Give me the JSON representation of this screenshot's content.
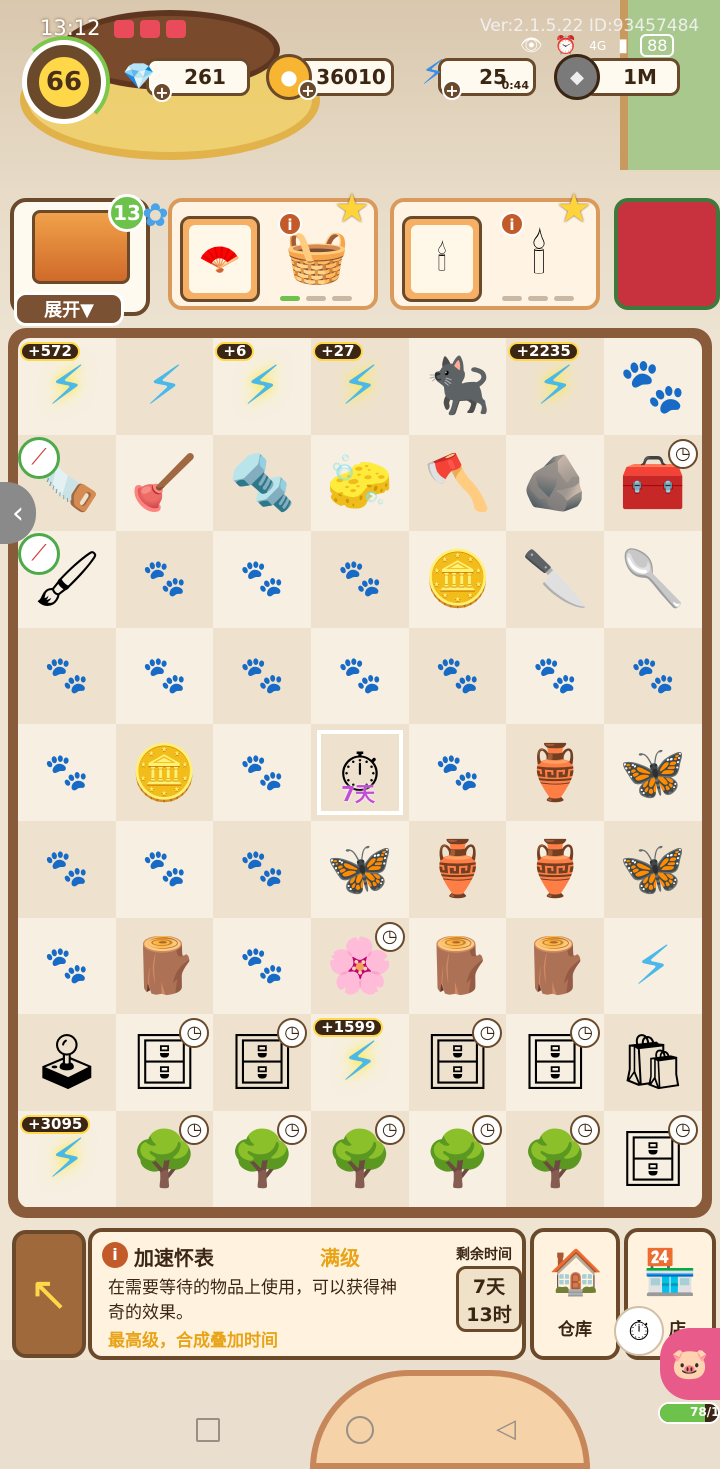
{
  "status_bar": {
    "time": "13:12",
    "version": "Ver:2.1.5.22 ID:93457484",
    "network": "4G",
    "battery": "88"
  },
  "player": {
    "level": "66",
    "level_progress": 0.35
  },
  "resources": {
    "gems": "261",
    "coins": "36010",
    "energy": "25",
    "energy_timer": "0:44",
    "seeds": "1M"
  },
  "chest": {
    "count": "13",
    "expand_label": "展开▼"
  },
  "orders": [
    {
      "tag_icon": "fan-icon",
      "item_icon": "yarn-basket-icon",
      "progress": "1/3"
    },
    {
      "tag_icon": "chandelier-small-icon",
      "item_icon": "chandelier-icon",
      "progress": "0/3"
    }
  ],
  "board": {
    "rows": [
      [
        {
          "icon": "⚡",
          "kind": "energy-machine",
          "bonus": "+572",
          "glow": true
        },
        {
          "icon": "⚡",
          "kind": "energy-shelf"
        },
        {
          "icon": "⚡",
          "kind": "energy-crate",
          "bonus": "+6",
          "glow": true
        },
        {
          "icon": "⚡",
          "kind": "energy-cart",
          "bonus": "+27",
          "glow": true
        },
        {
          "icon": "🐈‍⬛",
          "kind": "black-cat"
        },
        {
          "icon": "⚡",
          "kind": "energy-cart2",
          "bonus": "+2235",
          "glow": true
        },
        {
          "icon": "🐾",
          "kind": "cat-paw-toy"
        }
      ],
      [
        {
          "icon": "🪚",
          "kind": "saw",
          "candy": true
        },
        {
          "icon": "🪠",
          "kind": "plunger"
        },
        {
          "icon": "🔩",
          "kind": "screw"
        },
        {
          "icon": "🧽",
          "kind": "brush"
        },
        {
          "icon": "🪓",
          "kind": "axe"
        },
        {
          "icon": "🪨",
          "kind": "wood-chip"
        },
        {
          "icon": "🧰",
          "kind": "treasure-chest",
          "clock": true
        }
      ],
      [
        {
          "icon": "🖌",
          "kind": "paintbrush",
          "candy": true
        },
        {
          "icon": "",
          "kind": "empty"
        },
        {
          "icon": "",
          "kind": "empty"
        },
        {
          "icon": "",
          "kind": "empty"
        },
        {
          "icon": "🪙",
          "kind": "coin-pile"
        },
        {
          "icon": "🔪",
          "kind": "spatula"
        },
        {
          "icon": "🥄",
          "kind": "trowel"
        }
      ],
      [
        {
          "icon": "",
          "kind": "empty"
        },
        {
          "icon": "",
          "kind": "empty"
        },
        {
          "icon": "",
          "kind": "empty"
        },
        {
          "icon": "",
          "kind": "empty"
        },
        {
          "icon": "",
          "kind": "empty"
        },
        {
          "icon": "",
          "kind": "empty"
        },
        {
          "icon": "",
          "kind": "empty"
        }
      ],
      [
        {
          "icon": "",
          "kind": "empty"
        },
        {
          "icon": "🪙",
          "kind": "coins"
        },
        {
          "icon": "",
          "kind": "empty"
        },
        {
          "icon": "⏱",
          "kind": "speed-watch",
          "selected": true,
          "days": "7天"
        },
        {
          "icon": "",
          "kind": "empty"
        },
        {
          "icon": "🏺",
          "kind": "small-vase"
        },
        {
          "icon": "🦋",
          "kind": "butterfly-orange"
        }
      ],
      [
        {
          "icon": "",
          "kind": "empty"
        },
        {
          "icon": "",
          "kind": "empty"
        },
        {
          "icon": "",
          "kind": "empty"
        },
        {
          "icon": "🦋",
          "kind": "butterfly-yellow"
        },
        {
          "icon": "🏺",
          "kind": "jar"
        },
        {
          "icon": "🏺",
          "kind": "blue-vase"
        },
        {
          "icon": "🦋",
          "kind": "butterfly-blue"
        }
      ],
      [
        {
          "icon": "",
          "kind": "empty"
        },
        {
          "icon": "🪵",
          "kind": "logs"
        },
        {
          "icon": "",
          "kind": "empty"
        },
        {
          "icon": "🌸",
          "kind": "flower-pot",
          "clock": true
        },
        {
          "icon": "🪵",
          "kind": "broken-pot"
        },
        {
          "icon": "🪵",
          "kind": "broken-pot2"
        },
        {
          "icon": "⚡",
          "kind": "energy-bag"
        }
      ],
      [
        {
          "icon": "🕹",
          "kind": "arcade"
        },
        {
          "icon": "🗄",
          "kind": "dresser-flower",
          "clock": true
        },
        {
          "icon": "🗄",
          "kind": "dresser-flower2",
          "clock": true
        },
        {
          "icon": "⚡",
          "kind": "energy-pot",
          "bonus": "+1599",
          "glow": true
        },
        {
          "icon": "🗄",
          "kind": "dresser-orange",
          "clock": true
        },
        {
          "icon": "🗄",
          "kind": "nightstand",
          "clock": true
        },
        {
          "icon": "🛍",
          "kind": "paper-bag"
        }
      ],
      [
        {
          "icon": "⚡",
          "kind": "energy-tree",
          "bonus": "+3095",
          "glow": true
        },
        {
          "icon": "🌳",
          "kind": "fruit-tree",
          "clock": true
        },
        {
          "icon": "🌳",
          "kind": "fruit-tree2",
          "clock": true
        },
        {
          "icon": "🌳",
          "kind": "fruit-tree3",
          "clock": true
        },
        {
          "icon": "🌳",
          "kind": "bolt-tree",
          "clock": true
        },
        {
          "icon": "🌳",
          "kind": "bolt-tree2",
          "clock": true
        },
        {
          "icon": "🗄",
          "kind": "nightstand2",
          "clock": true
        }
      ]
    ]
  },
  "info_panel": {
    "title": "加速怀表",
    "level": "满级",
    "description": "在需要等待的物品上使用，可以获得神奇的效果。",
    "extra": "最高级，合成叠加时间",
    "remain_label": "剩余时间",
    "remain_days": "7天",
    "remain_hours": "13时"
  },
  "buttons": {
    "warehouse": "仓库",
    "shop": "店"
  },
  "piggy": {
    "progress_text": "78/1",
    "progress": 0.78
  }
}
